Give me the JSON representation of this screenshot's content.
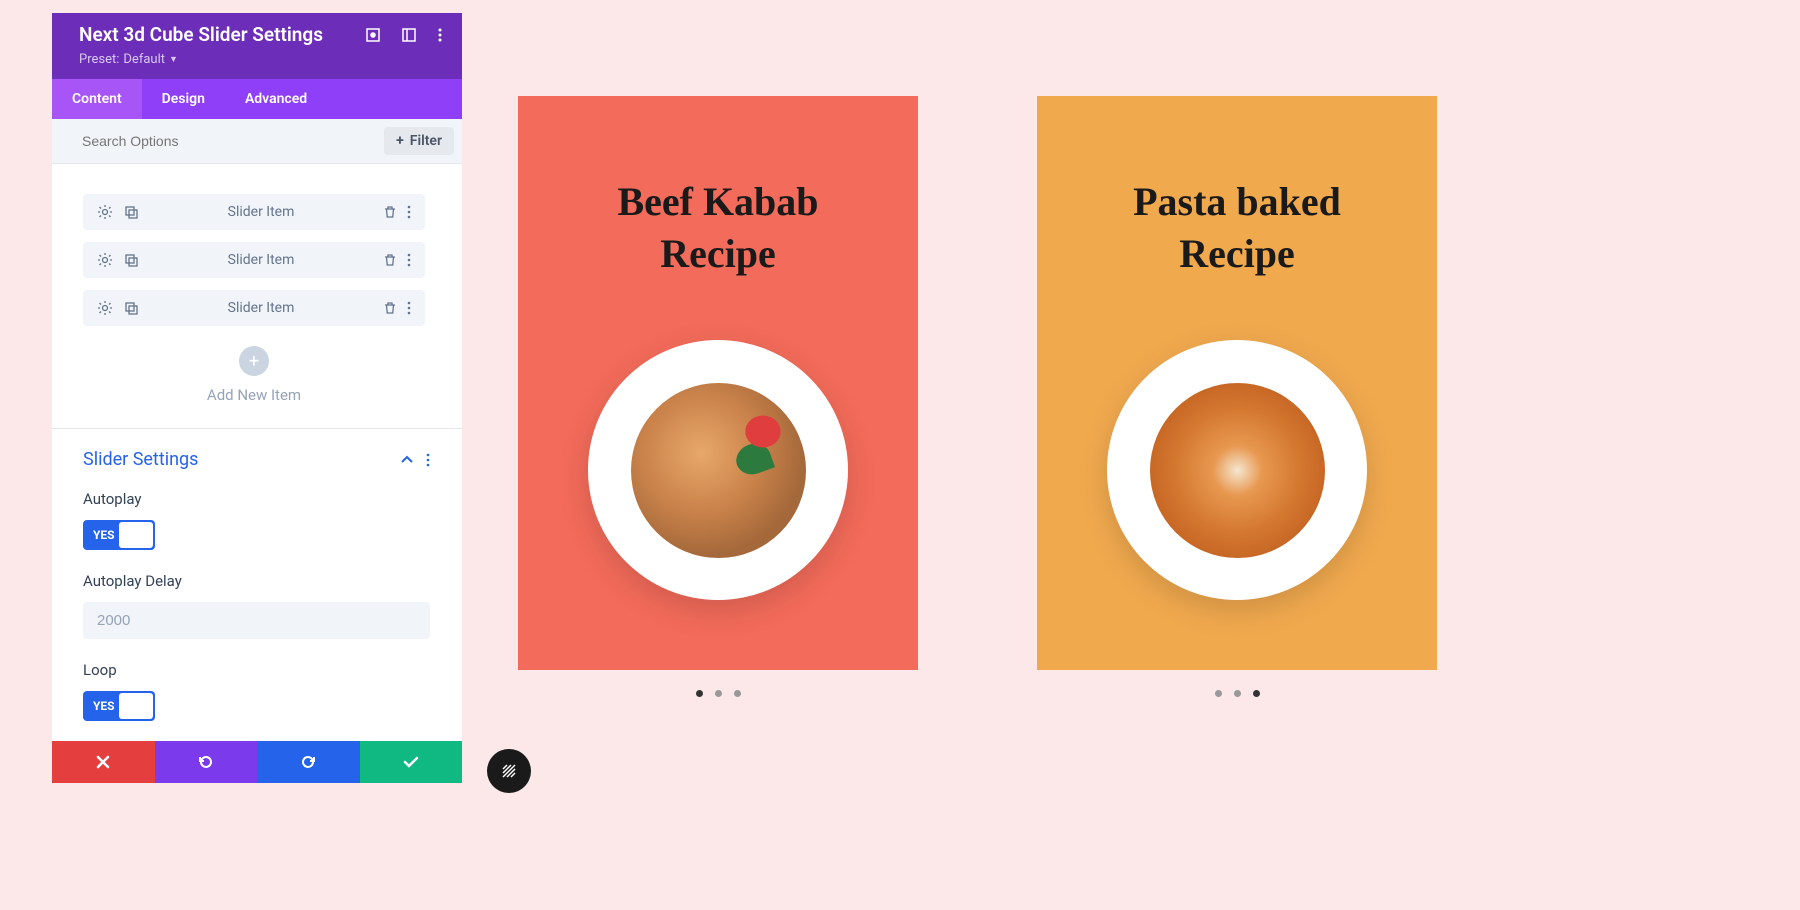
{
  "header": {
    "title": "Next 3d Cube Slider Settings",
    "preset_label": "Preset:",
    "preset_value": "Default"
  },
  "tabs": [
    {
      "label": "Content",
      "active": true
    },
    {
      "label": "Design",
      "active": false
    },
    {
      "label": "Advanced",
      "active": false
    }
  ],
  "search": {
    "placeholder": "Search Options",
    "filter_label": "Filter"
  },
  "items": [
    {
      "label": "Slider Item"
    },
    {
      "label": "Slider Item"
    },
    {
      "label": "Slider Item"
    }
  ],
  "add_new": {
    "label": "Add New Item"
  },
  "settings": {
    "section_title": "Slider Settings",
    "autoplay": {
      "label": "Autoplay",
      "value": "YES"
    },
    "autoplay_delay": {
      "label": "Autoplay Delay",
      "value": "2000"
    },
    "loop": {
      "label": "Loop",
      "value": "YES"
    }
  },
  "preview": {
    "card1": {
      "title_line1": "Beef Kabab",
      "title_line2": "Recipe"
    },
    "card2": {
      "title_line1": "Pasta baked",
      "title_line2": "Recipe"
    }
  }
}
